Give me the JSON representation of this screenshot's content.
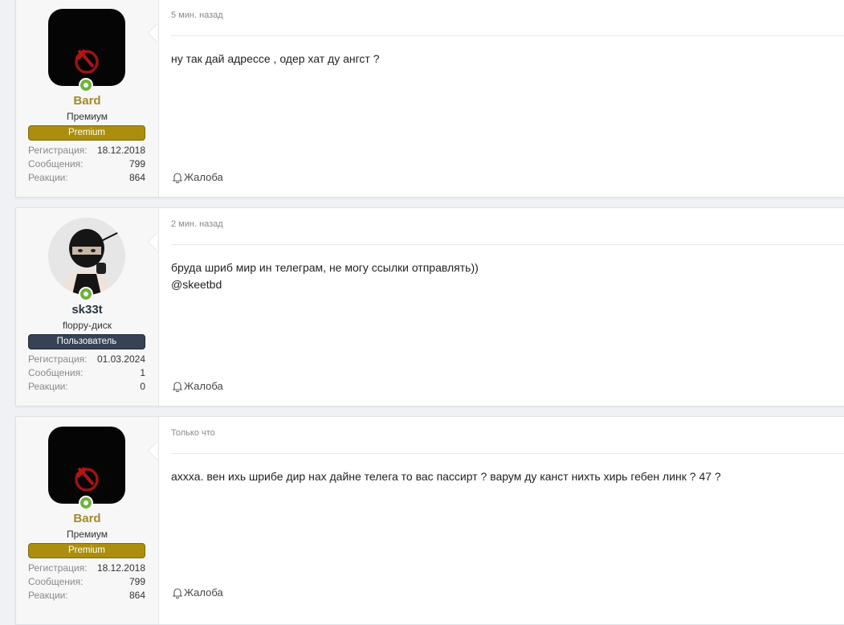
{
  "posts": [
    {
      "username": "Bard",
      "user_title": "Премиум",
      "banner": "Premium",
      "stats": [
        {
          "label": "Регистрация:",
          "value": "18.12.2018"
        },
        {
          "label": "Сообщения:",
          "value": "799"
        },
        {
          "label": "Реакции:",
          "value": "864"
        }
      ],
      "time": "5 мин. назад",
      "lines": [
        "ну так дай адрессе , одер хат ду ангст ?"
      ],
      "report": "Жалоба"
    },
    {
      "username": "sk33t",
      "user_title": "floppy-диск",
      "banner": "Пользователь",
      "stats": [
        {
          "label": "Регистрация:",
          "value": "01.03.2024"
        },
        {
          "label": "Сообщения:",
          "value": "1"
        },
        {
          "label": "Реакции:",
          "value": "0"
        }
      ],
      "time": "2 мин. назад",
      "lines": [
        "бруда шриб мир ин телеграм, не могу ссылки отправлять))",
        "@skeetbd"
      ],
      "report": "Жалоба"
    },
    {
      "username": "Bard",
      "user_title": "Премиум",
      "banner": "Premium",
      "stats": [
        {
          "label": "Регистрация:",
          "value": "18.12.2018"
        },
        {
          "label": "Сообщения:",
          "value": "799"
        },
        {
          "label": "Реакции:",
          "value": "864"
        }
      ],
      "time": "Только что",
      "lines": [
        "ахххa. вен ихь шрибе дир нах дайне телега то вас пассирт ? варум ду канст нихть хирь гебен линк ? 47 ?"
      ],
      "report": "Жалоба"
    }
  ],
  "colors": {
    "gold_name": "#a48a2d",
    "premium_banner": "#ab8e0e",
    "user_banner": "#374354",
    "online": "#6cb43a"
  }
}
